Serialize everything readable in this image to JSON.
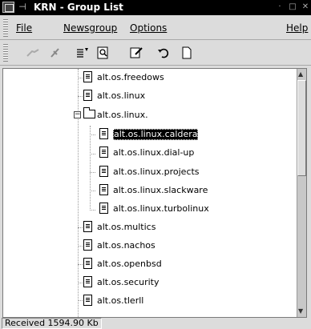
{
  "window": {
    "title": "KRN - Group List"
  },
  "menu": {
    "file": "File",
    "newsgroup": "Newsgroup",
    "options": "Options",
    "help": "Help"
  },
  "toolbar": {
    "buttons": [
      "post-icon",
      "unsubscribe-icon",
      "subscribe-icon",
      "search-icon",
      "edit-icon",
      "undo-icon",
      "new-document-icon"
    ]
  },
  "tree": {
    "items": [
      {
        "label": "alt.os.freedows",
        "type": "document",
        "level": 1
      },
      {
        "label": "alt.os.linux",
        "type": "document",
        "level": 1
      },
      {
        "label": "alt.os.linux.",
        "type": "folder",
        "level": 1,
        "expanded": true
      },
      {
        "label": "alt.os.linux.caldera",
        "type": "document",
        "level": 2,
        "selected": true
      },
      {
        "label": "alt.os.linux.dial-up",
        "type": "document",
        "level": 2
      },
      {
        "label": "alt.os.linux.projects",
        "type": "document",
        "level": 2
      },
      {
        "label": "alt.os.linux.slackware",
        "type": "document",
        "level": 2
      },
      {
        "label": "alt.os.linux.turbolinux",
        "type": "document",
        "level": 2
      },
      {
        "label": "alt.os.multics",
        "type": "document",
        "level": 1
      },
      {
        "label": "alt.os.nachos",
        "type": "document",
        "level": 1
      },
      {
        "label": "alt.os.openbsd",
        "type": "document",
        "level": 1
      },
      {
        "label": "alt.os.security",
        "type": "document",
        "level": 1
      },
      {
        "label": "alt.os.tlerll",
        "type": "document",
        "level": 1
      }
    ]
  },
  "status": {
    "received": "Received 1594.90 Kb"
  }
}
